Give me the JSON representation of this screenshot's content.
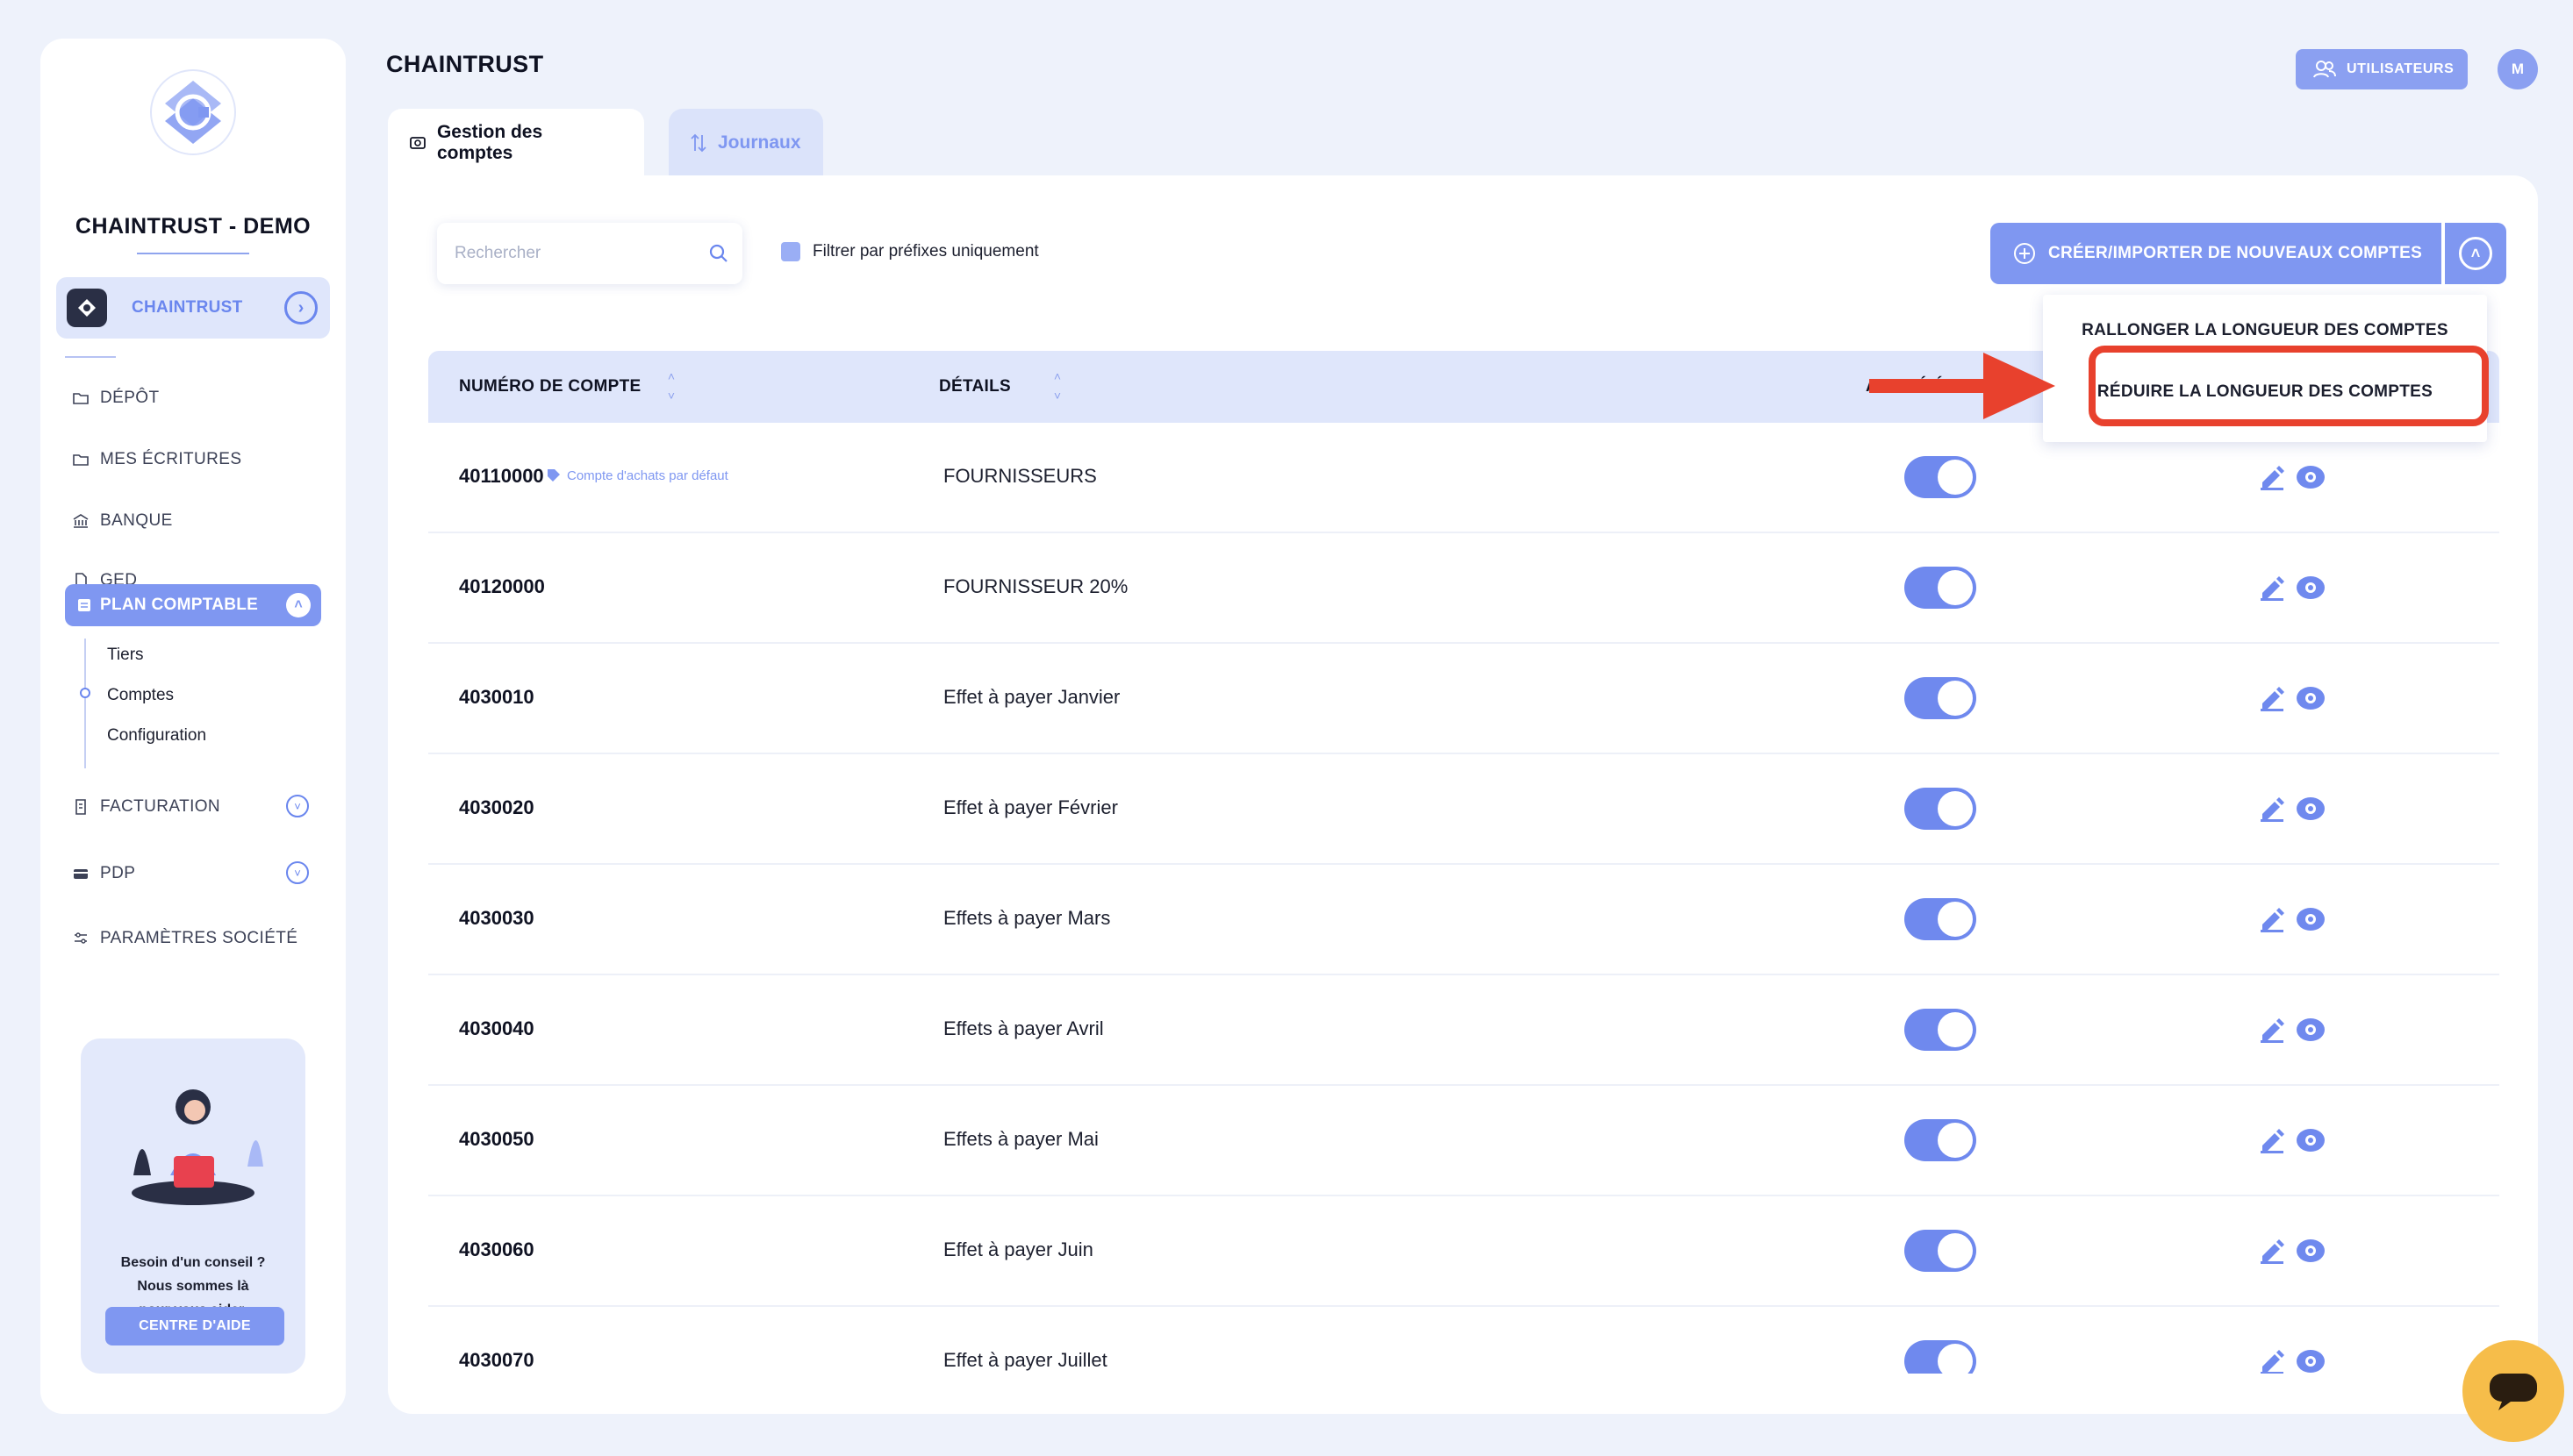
{
  "sidebar": {
    "company_name": "CHAINTRUST - DEMO",
    "company_switch_label": "CHAINTRUST",
    "nav": [
      {
        "label": "DÉPÔT",
        "icon": "folder-icon"
      },
      {
        "label": "MES ÉCRITURES",
        "icon": "folder-icon"
      },
      {
        "label": "BANQUE",
        "icon": "bank-icon"
      },
      {
        "label": "GED",
        "icon": "document-icon"
      }
    ],
    "active_section": "PLAN COMPTABLE",
    "sub_items": [
      "Tiers",
      "Comptes",
      "Configuration"
    ],
    "more_nav": [
      {
        "label": "FACTURATION",
        "icon": "invoice-icon"
      },
      {
        "label": "PDP",
        "icon": "card-icon"
      },
      {
        "label": "PARAMÈTRES SOCIÉTÉ",
        "icon": "sliders-icon"
      }
    ],
    "help": {
      "line1": "Besoin d'un conseil ?",
      "line2": "Nous sommes là",
      "line3": "pour vous aider.",
      "button": "CENTRE D'AIDE"
    }
  },
  "header": {
    "title": "CHAINTRUST",
    "users_button": "UTILISATEURS",
    "avatar_initial": "M"
  },
  "tabs": [
    {
      "label": "Gestion des comptes",
      "active": true
    },
    {
      "label": "Journaux",
      "active": false
    }
  ],
  "toolbar": {
    "search_placeholder": "Rechercher",
    "filter_label": "Filtrer par préfixes uniquement",
    "create_button": "CRÉER/IMPORTER DE NOUVEAUX COMPTES"
  },
  "dropdown": {
    "items": [
      "RALLONGER LA LONGUEUR DES COMPTES",
      "RÉDUIRE LA LONGUEUR DES COMPTES"
    ]
  },
  "table": {
    "columns": [
      "NUMÉRO DE COMPTE",
      "DÉTAILS",
      "ACTIVÉ/É"
    ],
    "rows": [
      {
        "number": "40110000",
        "tag": "Compte d'achats par défaut",
        "details": "FOURNISSEURS",
        "active": true
      },
      {
        "number": "40120000",
        "details": "FOURNISSEUR 20%",
        "active": true
      },
      {
        "number": "4030010",
        "details": "Effet à payer Janvier",
        "active": true
      },
      {
        "number": "4030020",
        "details": "Effet à payer Février",
        "active": true
      },
      {
        "number": "4030030",
        "details": "Effets à payer Mars",
        "active": true
      },
      {
        "number": "4030040",
        "details": "Effets à payer Avril",
        "active": true
      },
      {
        "number": "4030050",
        "details": "Effets à payer Mai",
        "active": true
      },
      {
        "number": "4030060",
        "details": "Effet à payer Juin",
        "active": true
      },
      {
        "number": "4030070",
        "details": "Effet à payer Juillet",
        "active": true
      }
    ]
  },
  "colors": {
    "accent": "#7f97f1",
    "background": "#eef2fb",
    "highlight": "#e8412d",
    "chat": "#f6bd4a"
  }
}
